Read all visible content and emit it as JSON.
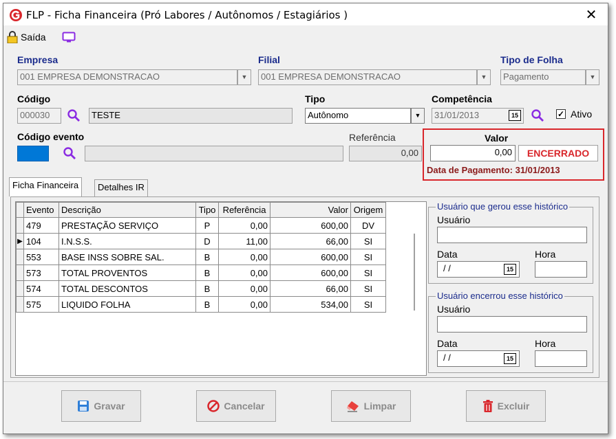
{
  "window": {
    "title": "FLP - Ficha Financeira (Pró Labores / Autônomos / Estagiários )",
    "close_glyph": "✕"
  },
  "toolbar": {
    "exit_label": "Saída",
    "exit_icon": "lock-icon",
    "screen_icon": "monitor-icon"
  },
  "empresa": {
    "label": "Empresa",
    "value": "001 EMPRESA DEMONSTRACAO"
  },
  "filial": {
    "label": "Filial",
    "value": "001 EMPRESA DEMONSTRACAO"
  },
  "tipo_folha": {
    "label": "Tipo de Folha",
    "value": "Pagamento"
  },
  "codigo": {
    "label": "Código",
    "value": "000030",
    "name": "TESTE"
  },
  "tipo": {
    "label": "Tipo",
    "value": "Autônomo"
  },
  "competencia": {
    "label": "Competência",
    "value": "31/01/2013",
    "calendar_glyph": "15"
  },
  "ativo": {
    "label": "Ativo",
    "checked": true,
    "check_glyph": "✓"
  },
  "codigo_evento": {
    "label": "Código evento",
    "value": "",
    "desc": ""
  },
  "referencia": {
    "label": "Referência",
    "value": "0,00"
  },
  "valor": {
    "label": "Valor",
    "value": "0,00",
    "status": "ENCERRADO",
    "pagamento": "Data de Pagamento: 31/01/2013"
  },
  "tabs": [
    {
      "label": "Ficha Financeira",
      "active": true
    },
    {
      "label": "Detalhes IR",
      "active": false
    }
  ],
  "grid": {
    "columns": [
      "Evento",
      "Descrição",
      "Tipo",
      "Referência",
      "Valor",
      "Origem"
    ],
    "current_marker": "▶",
    "rows": [
      {
        "evento": "479",
        "descricao": "PRESTAÇÃO SERVIÇO",
        "tipo": "P",
        "referencia": "0,00",
        "valor": "600,00",
        "origem": "DV",
        "current": false
      },
      {
        "evento": "104",
        "descricao": "I.N.S.S.",
        "tipo": "D",
        "referencia": "11,00",
        "valor": "66,00",
        "origem": "SI",
        "current": true
      },
      {
        "evento": "553",
        "descricao": "BASE INSS SOBRE SAL.",
        "tipo": "B",
        "referencia": "0,00",
        "valor": "600,00",
        "origem": "SI",
        "current": false
      },
      {
        "evento": "573",
        "descricao": "TOTAL PROVENTOS",
        "tipo": "B",
        "referencia": "0,00",
        "valor": "600,00",
        "origem": "SI",
        "current": false
      },
      {
        "evento": "574",
        "descricao": "TOTAL DESCONTOS",
        "tipo": "B",
        "referencia": "0,00",
        "valor": "66,00",
        "origem": "SI",
        "current": false
      },
      {
        "evento": "575",
        "descricao": "LIQUIDO FOLHA",
        "tipo": "B",
        "referencia": "0,00",
        "valor": "534,00",
        "origem": "SI",
        "current": false
      }
    ]
  },
  "gerou": {
    "title": "Usuário que gerou esse histórico",
    "usuario_label": "Usuário",
    "usuario_value": "",
    "data_label": "Data",
    "data_value": "/ /",
    "hora_label": "Hora",
    "hora_value": "",
    "calendar_glyph": "15"
  },
  "encerrou": {
    "title": "Usuário encerrou esse histórico",
    "usuario_label": "Usuário",
    "usuario_value": "",
    "data_label": "Data",
    "data_value": "/ /",
    "hora_label": "Hora",
    "hora_value": "",
    "calendar_glyph": "15"
  },
  "buttons": {
    "gravar": "Gravar",
    "cancelar": "Cancelar",
    "limpar": "Limpar",
    "excluir": "Excluir"
  },
  "colors": {
    "label_blue": "#1a2b8c",
    "alert_red": "#d9262b",
    "status_dark_red": "#8b1a1a",
    "icon_purple": "#8a2be2"
  }
}
